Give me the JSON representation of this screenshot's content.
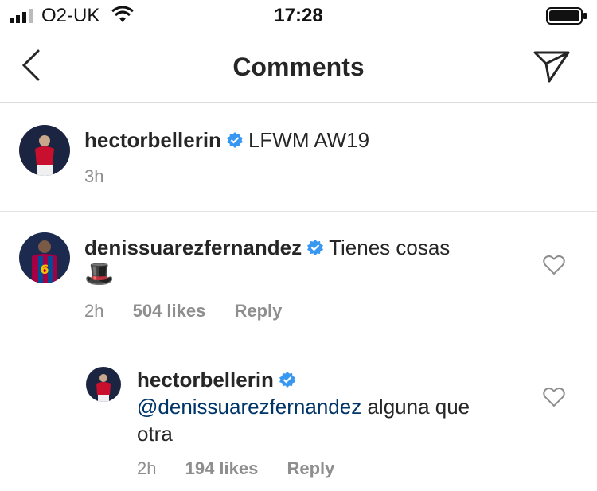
{
  "status_bar": {
    "carrier": "O2-UK",
    "time": "17:28"
  },
  "nav": {
    "title": "Comments"
  },
  "caption": {
    "username": "hectorbellerin",
    "text": "LFWM AW19",
    "time": "3h"
  },
  "comments": [
    {
      "username": "denissuarezfernandez",
      "text": "Tienes cosas",
      "emoji": "🎩",
      "time": "2h",
      "likes": "504 likes",
      "reply": "Reply"
    },
    {
      "username": "hectorbellerin",
      "mention": "@denissuarezfernandez",
      "text_line1": " alguna que",
      "text_line2": "otra",
      "time": "2h",
      "likes": "194 likes",
      "reply": "Reply"
    }
  ],
  "colors": {
    "verified": "#3897f0",
    "meta": "#8e8e8e",
    "mention": "#003569"
  },
  "icons": [
    "signal-icon",
    "wifi-icon",
    "battery-icon",
    "back-icon",
    "send-icon",
    "verified-icon",
    "heart-icon"
  ]
}
